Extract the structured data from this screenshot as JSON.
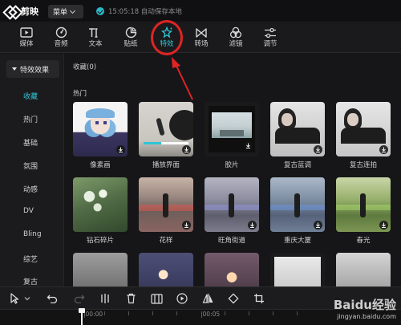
{
  "app": {
    "name": "剪映",
    "menu_label": "菜单",
    "save_status": "15:05:18 自动保存本地"
  },
  "toolbar": [
    {
      "key": "media",
      "label": "媒体",
      "icon": "media-icon"
    },
    {
      "key": "audio",
      "label": "音频",
      "icon": "audio-icon"
    },
    {
      "key": "text",
      "label": "文本",
      "icon": "text-icon"
    },
    {
      "key": "sticker",
      "label": "贴纸",
      "icon": "sticker-icon"
    },
    {
      "key": "effects",
      "label": "特效",
      "icon": "effects-icon",
      "active": true
    },
    {
      "key": "transition",
      "label": "转场",
      "icon": "transition-icon"
    },
    {
      "key": "filter",
      "label": "滤镜",
      "icon": "filter-icon"
    },
    {
      "key": "adjust",
      "label": "调节",
      "icon": "adjust-icon"
    }
  ],
  "sidebar": {
    "header": "特效效果",
    "items": [
      "收藏",
      "热门",
      "基础",
      "氛围",
      "动感",
      "DV",
      "Bling",
      "综艺",
      "复古"
    ],
    "active_index": 0
  },
  "main": {
    "favorites_label": "收藏(0)",
    "hot_label": "热门",
    "row1": [
      {
        "label": "像素画",
        "has_download": true
      },
      {
        "label": "播放界面",
        "has_download": true
      },
      {
        "label": "胶片",
        "has_download": true
      },
      {
        "label": "复古蓝调",
        "has_download": true
      },
      {
        "label": "复古连拍",
        "has_download": true
      }
    ],
    "row2": [
      {
        "label": "钻石碎片",
        "has_download": false
      },
      {
        "label": "花样",
        "has_download": true
      },
      {
        "label": "旺角街道",
        "has_download": true
      },
      {
        "label": "重庆大厦",
        "has_download": true
      },
      {
        "label": "春光",
        "has_download": true
      }
    ]
  },
  "bottom_toolbar": [
    "select-cursor-icon",
    "select-dropdown-icon",
    "undo-icon",
    "redo-icon",
    "split-icon",
    "delete-icon",
    "freeze-icon",
    "play-reverse-icon",
    "mirror-icon",
    "rotate-icon",
    "crop-icon"
  ],
  "timeline": {
    "label_0": "|00:00",
    "label_1": "|00:05"
  },
  "watermark": {
    "brand": "Baidu经验",
    "url": "jingyan.baidu.com"
  },
  "colors": {
    "accent": "#2ec5d6",
    "annotation": "#e02424",
    "background": "#151515"
  }
}
